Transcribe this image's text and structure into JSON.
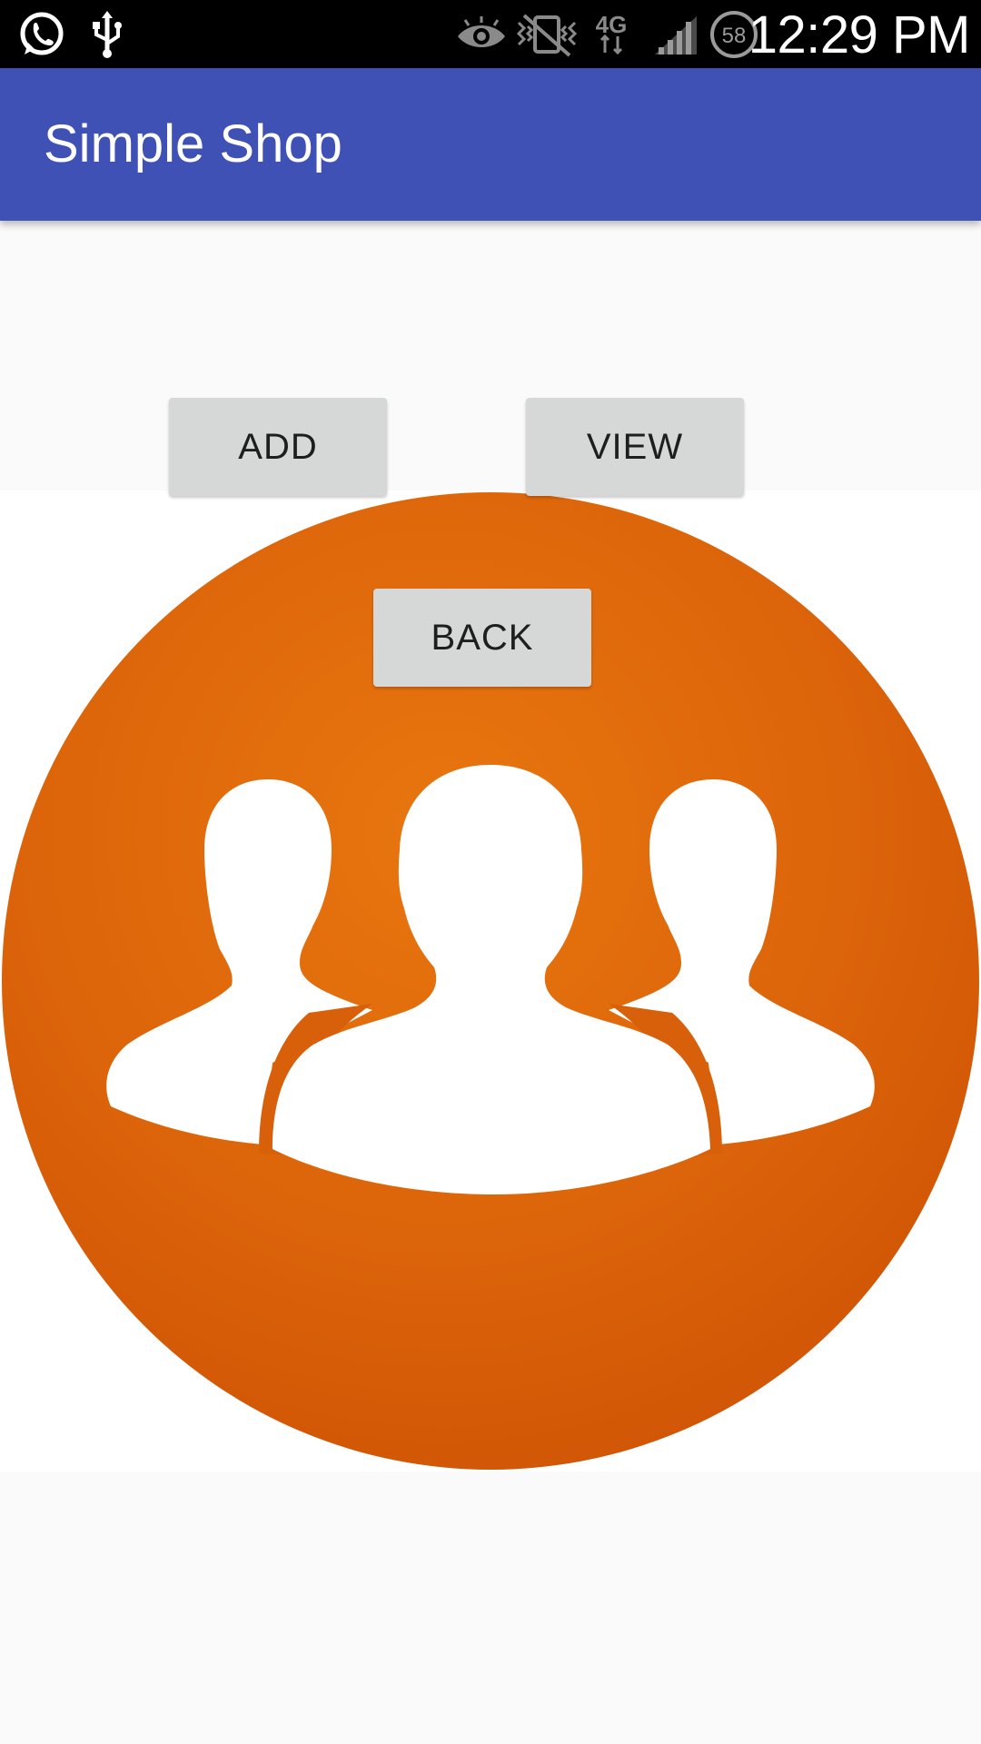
{
  "status_bar": {
    "time": "12:29 PM",
    "battery_level": "58",
    "network_type": "4G",
    "icons": [
      "whatsapp-icon",
      "usb-icon",
      "eye-icon",
      "vibrate-mute-icon",
      "network-4g-icon",
      "signal-icon",
      "battery-icon"
    ]
  },
  "app_bar": {
    "title": "Simple Shop",
    "color": "#3f51b5"
  },
  "buttons": {
    "add": "ADD",
    "view": "VIEW",
    "back": "BACK"
  },
  "hero_image": {
    "icon": "user-group-icon",
    "circle_color": "#e06a12",
    "figure_color": "#ffffff"
  }
}
